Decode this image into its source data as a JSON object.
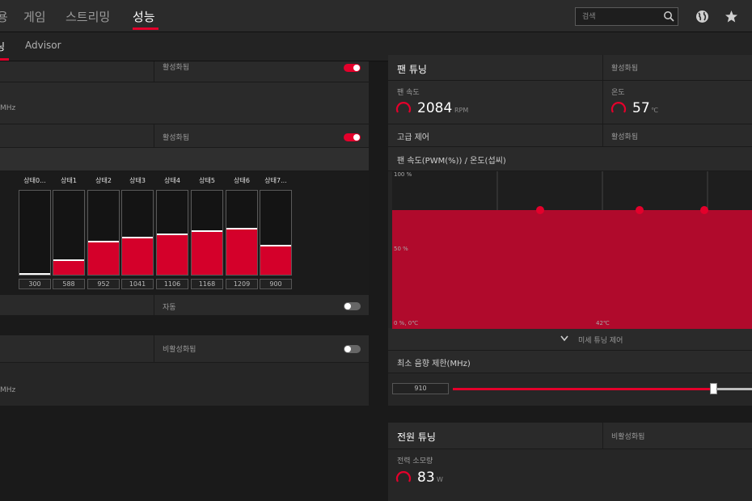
{
  "topnav": {
    "items": [
      {
        "label": "용"
      },
      {
        "label": "게임"
      },
      {
        "label": "스트리밍"
      },
      {
        "label": "성능"
      }
    ]
  },
  "search": {
    "placeholder": "검색"
  },
  "subnav": {
    "items": [
      {
        "label": "닝"
      },
      {
        "label": "Advisor"
      }
    ]
  },
  "left": {
    "row1_status": "활성화됨",
    "row2_unit": "MHz",
    "row3_status": "활성화됨",
    "states": [
      {
        "label": "상태0...",
        "value": "300",
        "level": 0.02
      },
      {
        "label": "상태1",
        "value": "588",
        "level": 0.18
      },
      {
        "label": "상태2",
        "value": "952",
        "level": 0.4
      },
      {
        "label": "상태3",
        "value": "1041",
        "level": 0.45
      },
      {
        "label": "상태4",
        "value": "1106",
        "level": 0.49
      },
      {
        "label": "상태5",
        "value": "1168",
        "level": 0.53
      },
      {
        "label": "상태6",
        "value": "1209",
        "level": 0.56
      },
      {
        "label": "상태7...",
        "value": "900",
        "level": 0.36
      }
    ],
    "auto_label": "자동",
    "lower_status": "비활성화됨",
    "lower_unit": "MHz"
  },
  "fan": {
    "title": "팬 튜닝",
    "status": "활성화됨",
    "speed_label": "팬 속도",
    "speed_value": "2084",
    "speed_unit": "RPM",
    "temp_label": "온도",
    "temp_value": "57",
    "temp_unit": "℃",
    "advanced_label": "고급 제어",
    "advanced_status": "활성화됨",
    "curve_title": "팬 속도(PWM(%)) / 온도(섭씨)",
    "y_top": "100 %",
    "y_mid": "50 %",
    "origin": "0 %, 0℃",
    "x_mid": "42℃",
    "fine_tune": "미세 튜닝 제어",
    "min_speed_label": "최소 음향 제한(MHz)",
    "min_speed_value": "910",
    "min_speed_level": 0.87
  },
  "power": {
    "title": "전원 튜닝",
    "status": "비활성화됨",
    "consumption_label": "전력 소모량",
    "consumption_value": "83",
    "consumption_unit": "W"
  },
  "colors": {
    "accent": "#e3002b",
    "panel": "#262626",
    "bg": "#1a1a1a"
  }
}
